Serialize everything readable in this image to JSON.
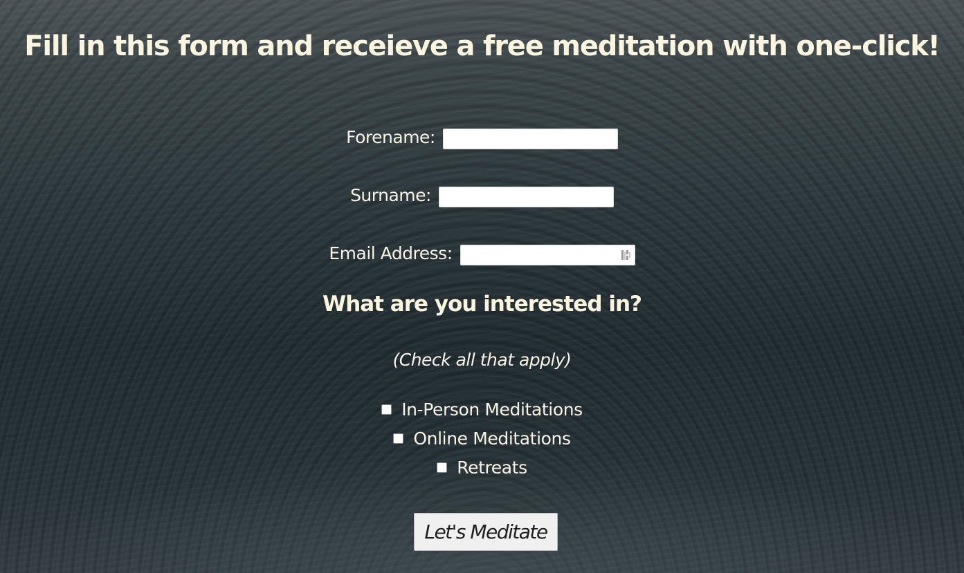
{
  "page": {
    "title": "Fill in this form and receieve a free meditation with one-click!"
  },
  "form": {
    "forename": {
      "label": "Forename:",
      "value": ""
    },
    "surname": {
      "label": "Surname:",
      "value": ""
    },
    "email": {
      "label": "Email Address:",
      "value": ""
    },
    "interests": {
      "heading": "What are you interested in?",
      "hint": "(Check all that apply)",
      "options": [
        {
          "label": "In-Person Meditations",
          "checked": false
        },
        {
          "label": "Online Meditations",
          "checked": false
        },
        {
          "label": "Retreats",
          "checked": false
        }
      ]
    },
    "submit_label": "Let's Meditate"
  },
  "icons": {
    "email_field": "password-manager-icon"
  },
  "colors": {
    "text": "#fbf5df",
    "button_bg": "#f0f0f0",
    "input_bg": "#ffffff"
  }
}
